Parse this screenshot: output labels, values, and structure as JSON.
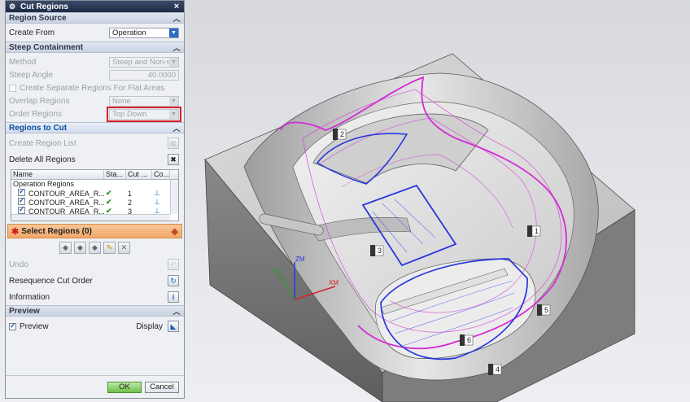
{
  "dialog": {
    "title": "Cut Regions",
    "sections": {
      "region_source": "Region Source",
      "steep_containment": "Steep Containment",
      "regions_to_cut": "Regions to Cut",
      "preview": "Preview"
    },
    "region_source": {
      "create_from_label": "Create From",
      "create_from_value": "Operation"
    },
    "steep": {
      "method_label": "Method",
      "method_value": "Steep and Non-st",
      "steep_angle_label": "Steep Angle",
      "steep_angle_value": "40.0000",
      "separate_regions_label": "Create Separate Regions For Flat Areas",
      "overlap_label": "Overlap Regions",
      "overlap_value": "None",
      "order_label": "Order Regions",
      "order_value": "Top Down"
    },
    "regions": {
      "create_list_label": "Create Region List",
      "delete_all_label": "Delete All Regions",
      "table_headers": [
        "Name",
        "Sta...",
        "Cut ...",
        "Co..."
      ],
      "group_label": "Operation Regions",
      "rows": [
        {
          "name": "CONTOUR_AREA_R...",
          "order": "1"
        },
        {
          "name": "CONTOUR_AREA_R...",
          "order": "2"
        },
        {
          "name": "CONTOUR_AREA_R...",
          "order": "3"
        }
      ],
      "select_regions_label": "Select Regions (0)",
      "undo_label": "Undo",
      "resequence_label": "Resequence Cut Order",
      "information_label": "Information"
    },
    "preview": {
      "preview_label": "Preview",
      "display_label": "Display"
    },
    "ok_label": "OK",
    "cancel_label": "Cancel"
  },
  "viewport": {
    "region_labels": [
      "1",
      "2",
      "3",
      "4",
      "5",
      "6"
    ],
    "axis_labels": {
      "z": "ZM",
      "x": "XM",
      "y": "YM"
    }
  },
  "colors": {
    "highlight_red": "#d6222a",
    "region_blue": "#2a35e0",
    "toolpath_magenta": "#d22ad6",
    "ok_green": "#6cc14a"
  }
}
